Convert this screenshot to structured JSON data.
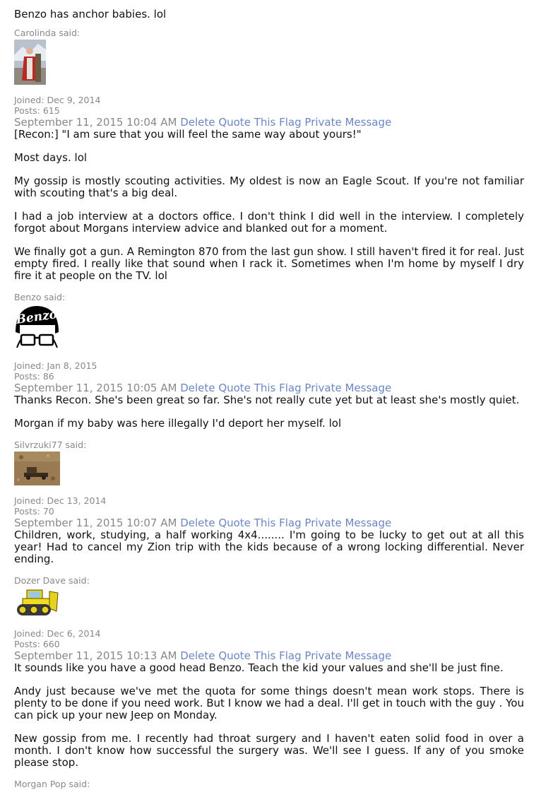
{
  "intro_text": "Benzo has anchor babies. lol",
  "actions": {
    "delete": "Delete",
    "quote": "Quote This",
    "flag": "Flag",
    "pm": "Private Message"
  },
  "posts": [
    {
      "author": "Carolinda said:",
      "avatar_icon": "person-in-red-photo-avatar",
      "joined": "Joined: Dec 9, 2014",
      "posts": "Posts: 615",
      "timestamp": "September 11, 2015 10:04 AM",
      "paragraphs": [
        "[Recon:] \"I am sure that you will feel the same way about yours!\"",
        "Most days. lol",
        "My gossip is mostly scouting activities. My oldest is now an Eagle Scout. If you're not familiar with scouting that's a big deal.",
        "I had a job interview at a doctors office. I don't think I did well in the interview. I completely forgot about Morgans interview advice and blanked out for a moment.",
        "We finally got a gun. A Remington 870 from the last gun show. I still haven't fired it for real. Just empty fired. I really like that sound when I rack it. Sometimes when I'm home by myself I dry fire it at people on the TV. lol"
      ]
    },
    {
      "author": "Benzo said:",
      "avatar_icon": "benzo-logo-avatar",
      "avatar_text": "Benzo",
      "joined": "Joined: Jan 8, 2015",
      "posts": "Posts: 86",
      "timestamp": "September 11, 2015 10:05 AM",
      "paragraphs": [
        "Thanks Recon. She's been great so far. She's not really cute yet but at least she's mostly quiet.",
        "Morgan if my baby was here illegally I'd deport her myself. lol"
      ]
    },
    {
      "author": "Silvrzuki77 said:",
      "avatar_icon": "dirt-terrain-photo-avatar",
      "joined": "Joined: Dec 13, 2014",
      "posts": "Posts: 70",
      "timestamp": "September 11, 2015 10:07 AM",
      "paragraphs": [
        "Children, work, studying, a half working 4x4........ I'm going to be lucky to get out at all this year! Had to cancel my Zion trip with the kids because of a wrong locking differential. Never ending."
      ]
    },
    {
      "author": "Dozer Dave said:",
      "avatar_icon": "yellow-tractor-avatar",
      "joined": "Joined: Dec 6, 2014",
      "posts": "Posts: 660",
      "timestamp": "September 11, 2015 10:13 AM",
      "paragraphs": [
        "It sounds like you have a good head Benzo. Teach the kid your values and she'll be just fine.",
        "Andy just because we've met the quota for some things doesn't mean work stops. There is plenty to be done if you need work. But I know we had a deal. I'll get in touch with the guy . You can pick up your new Jeep on Monday.",
        "New gossip from me. I recently had throat surgery and I haven't eaten solid food in over a month. I don't know how successful the surgery was. We'll see I guess. If any of you smoke please stop."
      ]
    }
  ],
  "next_author": "Morgan Pop said:"
}
